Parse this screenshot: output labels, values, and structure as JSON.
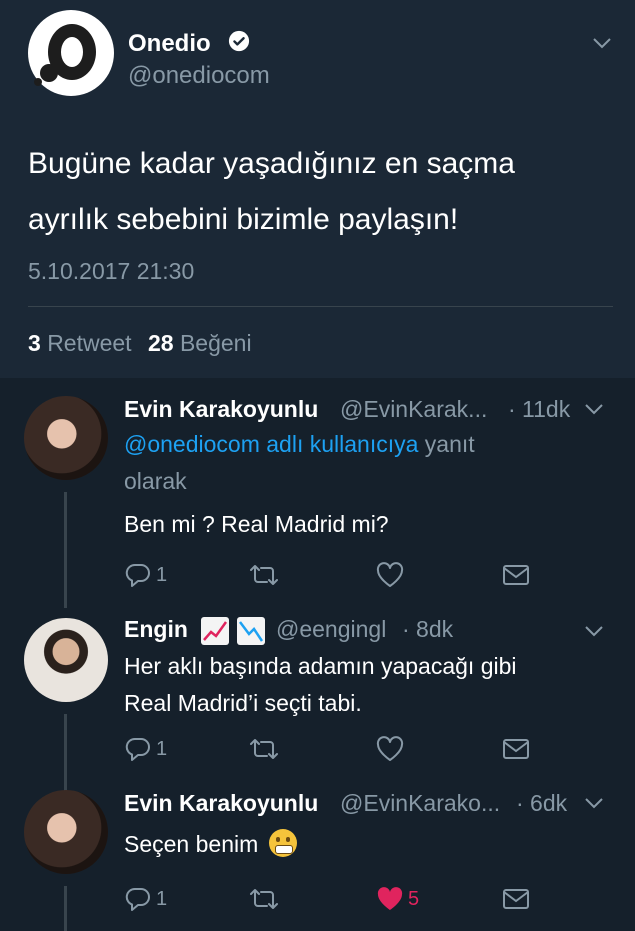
{
  "tweet": {
    "author_name": "Onedio",
    "handle": "@onediocom",
    "text_line1": "Bugüne kadar yaşadığınız en saçma",
    "text_line2": "ayrılık sebebini bizimle paylaşın!",
    "date": "5.10.2017 21:30",
    "retweet_count": "3",
    "retweet_label": "Retweet",
    "like_count": "28",
    "like_label": "Beğeni"
  },
  "replies": [
    {
      "name": "Evin Karakoyunlu",
      "handle": "@EvinKarak...",
      "time": "· 11dk",
      "reply_mention": "@onediocom adlı kullanıcıya",
      "reply_suffix": "yanıt",
      "reply_suffix2": "olarak",
      "text": "Ben mi ? Real Madrid mi?",
      "reply_count": "1",
      "like_count": ""
    },
    {
      "name": "Engin",
      "handle": "@eengingl",
      "time": "· 8dk",
      "text_line1": "Her aklı başında adamın yapacağı gibi",
      "text_line2": "Real Madrid’i seçti tabi.",
      "reply_count": "1",
      "like_count": ""
    },
    {
      "name": "Evin Karakoyunlu",
      "handle": "@EvinKarako...",
      "time": "· 6dk",
      "text": "Seçen benim",
      "emoji": "grimacing-face-emoji",
      "reply_count": "1",
      "like_count": "5"
    }
  ],
  "colors": {
    "background": "#1b2836",
    "reply_background": "#15202b",
    "text": "#ffffff",
    "muted": "#8899a6",
    "link": "#1da1f2",
    "like_active": "#e0245e",
    "divider": "#38444d"
  },
  "icons": [
    "verified-badge-icon",
    "chevron-down-icon",
    "reply-icon",
    "retweet-icon",
    "heart-icon",
    "message-icon",
    "chart-up-emoji",
    "chart-down-emoji"
  ]
}
